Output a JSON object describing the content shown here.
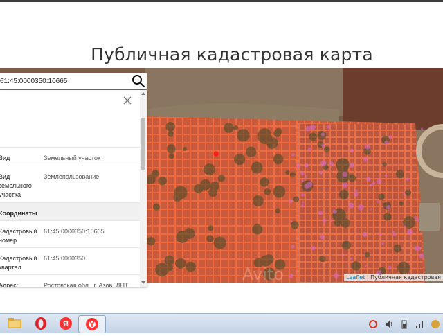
{
  "page": {
    "title": "Публичная кадастровая карта"
  },
  "search": {
    "value": "61:45:0000350:10665"
  },
  "info_panel": {
    "rows": [
      {
        "label": "Вид",
        "value": "Земельный участок"
      },
      {
        "label": "Вид земельного участка",
        "value": "Землепользование"
      },
      {
        "label": "Координаты",
        "value": ""
      },
      {
        "label": "Кадастровый номер",
        "value": "61:45:0000350:10665"
      },
      {
        "label": "Кадастровый квартал",
        "value": "61:45:0000350"
      },
      {
        "label": "Адрес:",
        "value": "Ростовская обл., г. Азов, ДНТ"
      }
    ]
  },
  "map": {
    "attribution_link": "Leaflet",
    "attribution_text": " | Публичная кадастровая",
    "watermark": "Avito",
    "colors": {
      "parcel_outline": "#e8522a",
      "parcel_fill": "#d8613e",
      "selected": "#ff1a1a"
    }
  },
  "taskbar": {
    "apps": [
      "file-explorer-icon",
      "opera-icon",
      "yandex-icon",
      "yandex-browser-icon"
    ],
    "tray": [
      "antivirus-icon",
      "speaker-icon",
      "battery-icon",
      "network-icon",
      "language-icon"
    ]
  }
}
